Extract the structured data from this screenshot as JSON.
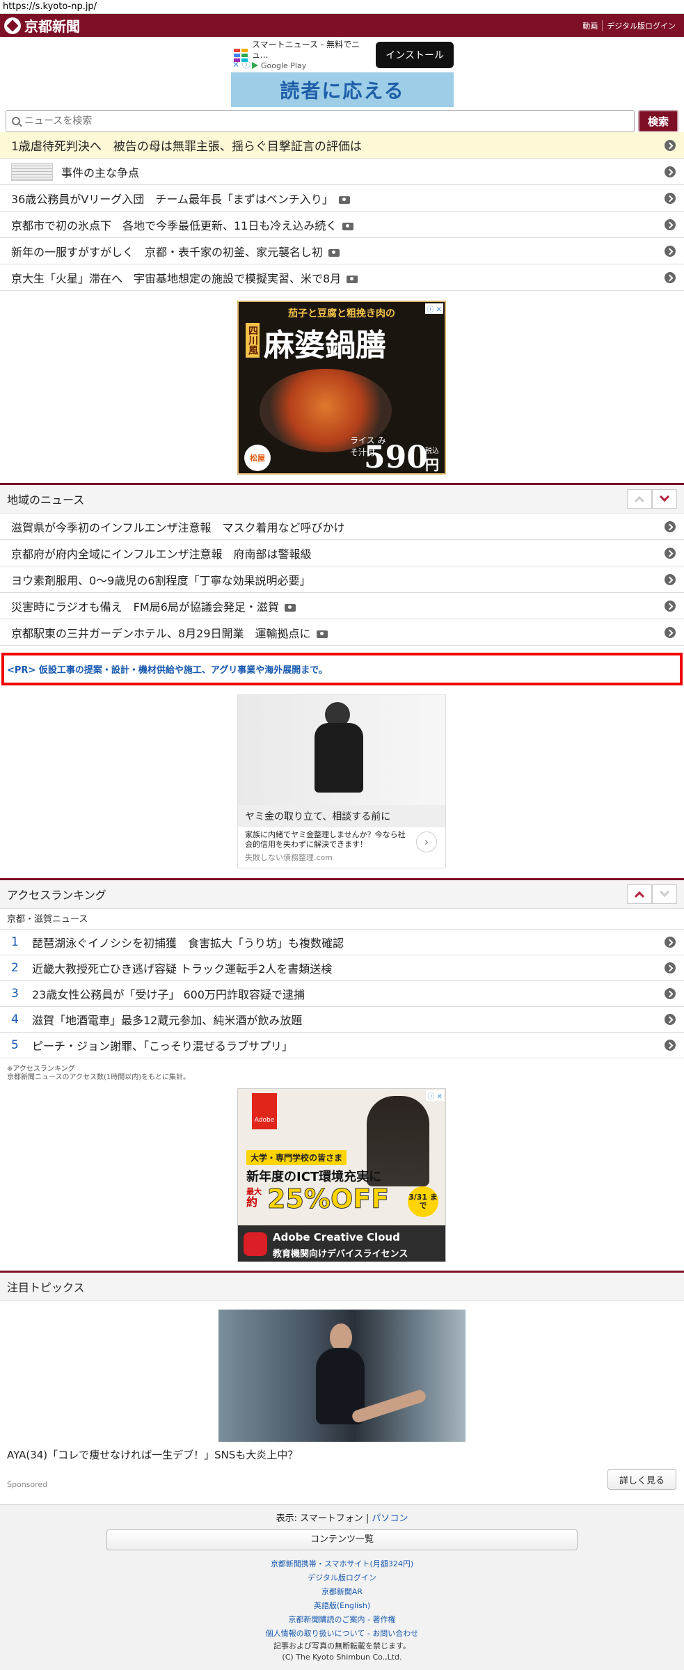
{
  "url": "https://s.kyoto-np.jp/",
  "header": {
    "logo_text": "京都新聞",
    "links": [
      "動画",
      "デジタル版ログイン"
    ]
  },
  "app_ad": {
    "title": "スマートニュース - 無料でニュ...",
    "store": "Google Play",
    "install_label": "インストール",
    "banner_text": "読者に応える"
  },
  "search": {
    "placeholder": "ニュースを検索",
    "button_label": "検索"
  },
  "top_news": [
    {
      "title": "1歳虐待死判決へ　被告の母は無罪主張、揺らぐ目撃証言の評価は",
      "camera": false
    },
    {
      "title": "事件の主な争点",
      "camera": false
    },
    {
      "title": "36歳公務員がVリーグ入団　チーム最年長「まずはベンチ入り」",
      "camera": true
    },
    {
      "title": "京都市で初の氷点下　各地で今季最低更新、11日も冷え込み続く",
      "camera": true
    },
    {
      "title": "新年の一服すがすがしく　京都・表千家の初釜、家元襲名し初",
      "camera": true
    },
    {
      "title": "京大生「火星」滞在へ　宇宙基地想定の施設で模擬実習、米で8月",
      "camera": true
    }
  ],
  "ad1": {
    "top": "茄子と豆腐と粗挽き肉の",
    "side": "四川風",
    "main": "麻婆鍋膳",
    "sub": "ライス みそ汁付",
    "price": "590",
    "yen": "円",
    "tax": "税込",
    "brand": "松屋"
  },
  "regional": {
    "title": "地域のニュース",
    "items": [
      {
        "title": "滋賀県が今季初のインフルエンザ注意報　マスク着用など呼びかけ",
        "camera": false
      },
      {
        "title": "京都府が府内全域にインフルエンザ注意報　府南部は警報級",
        "camera": false
      },
      {
        "title": "ヨウ素剤服用、0～9歳児の6割程度「丁寧な効果説明必要」",
        "camera": false
      },
      {
        "title": "災害時にラジオも備え　FM局6局が協議会発足・滋賀",
        "camera": true
      },
      {
        "title": "京都駅東の三井ガーデンホテル、8月29日開業　運輸拠点に",
        "camera": true
      }
    ]
  },
  "pr": {
    "text": "<PR> 仮設工事の提案・設計・機材供給や施工、アグリ事業や海外展開まで。"
  },
  "ad2": {
    "headline": "ヤミ金の取り立て、相談する前に",
    "body": "家族に内緒でヤミ金整理しませんか？今なら社会的信用を失わずに解決できます！",
    "source": "失敗しない債務整理",
    "source_domain": ".com"
  },
  "ranking": {
    "title": "アクセスランキング",
    "subtitle": "京都・滋賀ニュース",
    "items": [
      {
        "rank": "1",
        "title": "琵琶湖泳ぐイノシシを初捕獲　食害拡大「うり坊」も複数確認"
      },
      {
        "rank": "2",
        "title": "近畿大教授死亡ひき逃げ容疑 トラック運転手2人を書類送検"
      },
      {
        "rank": "3",
        "title": "23歳女性公務員が「受け子」 600万円詐取容疑で逮捕"
      },
      {
        "rank": "4",
        "title": "滋賀「地酒電車」最多12蔵元参加、純米酒が飲み放題"
      },
      {
        "rank": "5",
        "title": "ピーチ・ジョン謝罪、「こっそり混ぜるラブサプリ」"
      }
    ],
    "note1": "※アクセスランキング",
    "note2": "京都新聞ニュースのアクセス数(1時間以内)をもとに集計。"
  },
  "ad3": {
    "target": "大学・専門学校の皆さま",
    "headline": "新年度のICT環境充実に",
    "max": "最大",
    "approx": "約",
    "discount": "25%OFF",
    "deadline": "3/31 まで",
    "brand": "Adobe Creative Cloud",
    "product": "教育機関向けデバイスライセンス",
    "logo": "Adobe"
  },
  "topics": {
    "title": "注目トピックス",
    "item_title": "AYA(34)「コレで痩せなければ一生デブ！」SNSも大炎上中？",
    "sponsored": "Sponsored",
    "more_label": "詳しく見る"
  },
  "footer": {
    "display_label": "表示:",
    "smartphone": "スマートフォン",
    "pc": "パソコン",
    "contents_label": "コンテンツ一覧",
    "links": [
      "京都新聞携帯・スマホサイト(月額324円)",
      "デジタル版ログイン",
      "京都新聞AR",
      "英語版(English)",
      "京都新聞購読のご案内 - 著作権",
      "個人情報の取り扱いについて - お問い合わせ"
    ],
    "notice": "記事および写真の無断転載を禁じます。",
    "copyright": "(C) The Kyoto Shimbun Co.,Ltd."
  },
  "colors": {
    "brand": "#7d1027",
    "link": "#1759b0",
    "headline_bg": "#fdf8d6",
    "pr_border": "#ee0000"
  }
}
